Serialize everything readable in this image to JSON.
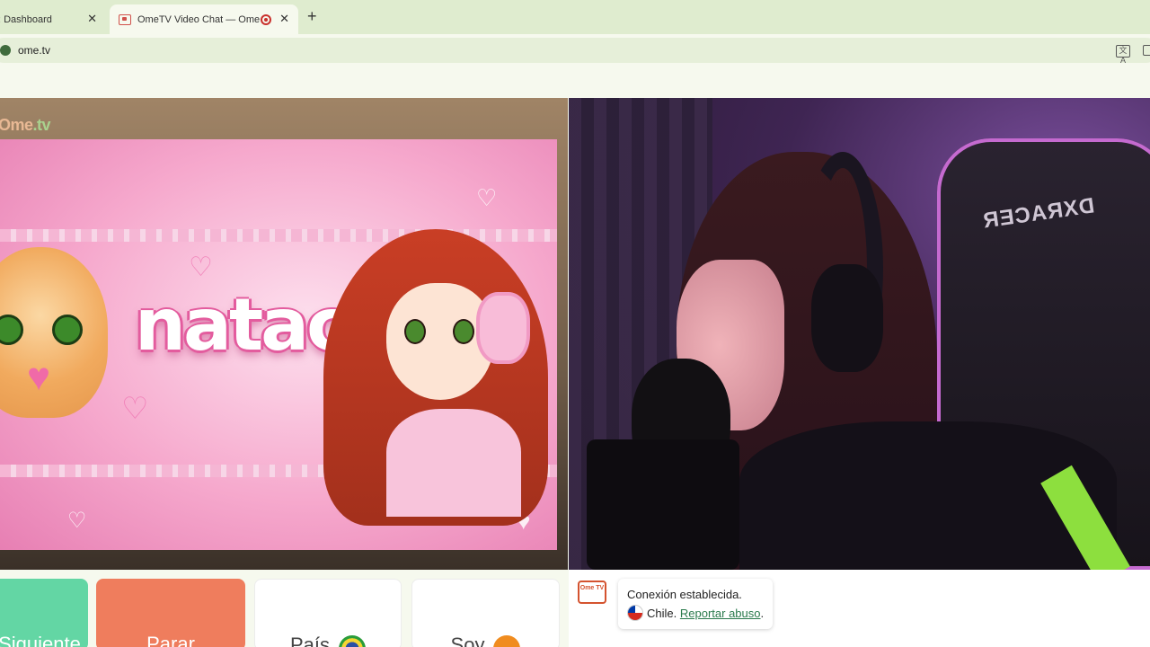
{
  "browser": {
    "tabs": [
      {
        "title": ": Dashboard",
        "active": false
      },
      {
        "title": "OmeTV Video Chat — Ome",
        "active": true,
        "recording": true
      }
    ],
    "new_tab_label": "+",
    "close_glyph": "✕",
    "url": "ome.tv",
    "translate_glyph": "文A"
  },
  "video_left": {
    "watermark_prefix": "Ome",
    "watermark_suffix": ".tv",
    "banner_name": "natacl"
  },
  "video_right": {
    "chair_brand": "DXRACER"
  },
  "controls": {
    "next_label": "Siguiente",
    "stop_label": "Parar",
    "country_label": "País",
    "gender_label": "Soy"
  },
  "chat": {
    "logo_text": "Ome TV",
    "status_text": "Conexión establecida.",
    "country_text": "Chile.",
    "report_link": "Reportar abuso",
    "trailing_period": "."
  },
  "colors": {
    "next_button": "#63d6a4",
    "stop_button": "#ef7d5d",
    "link": "#2a7a4c",
    "tabstrip": "#dfeccf"
  }
}
